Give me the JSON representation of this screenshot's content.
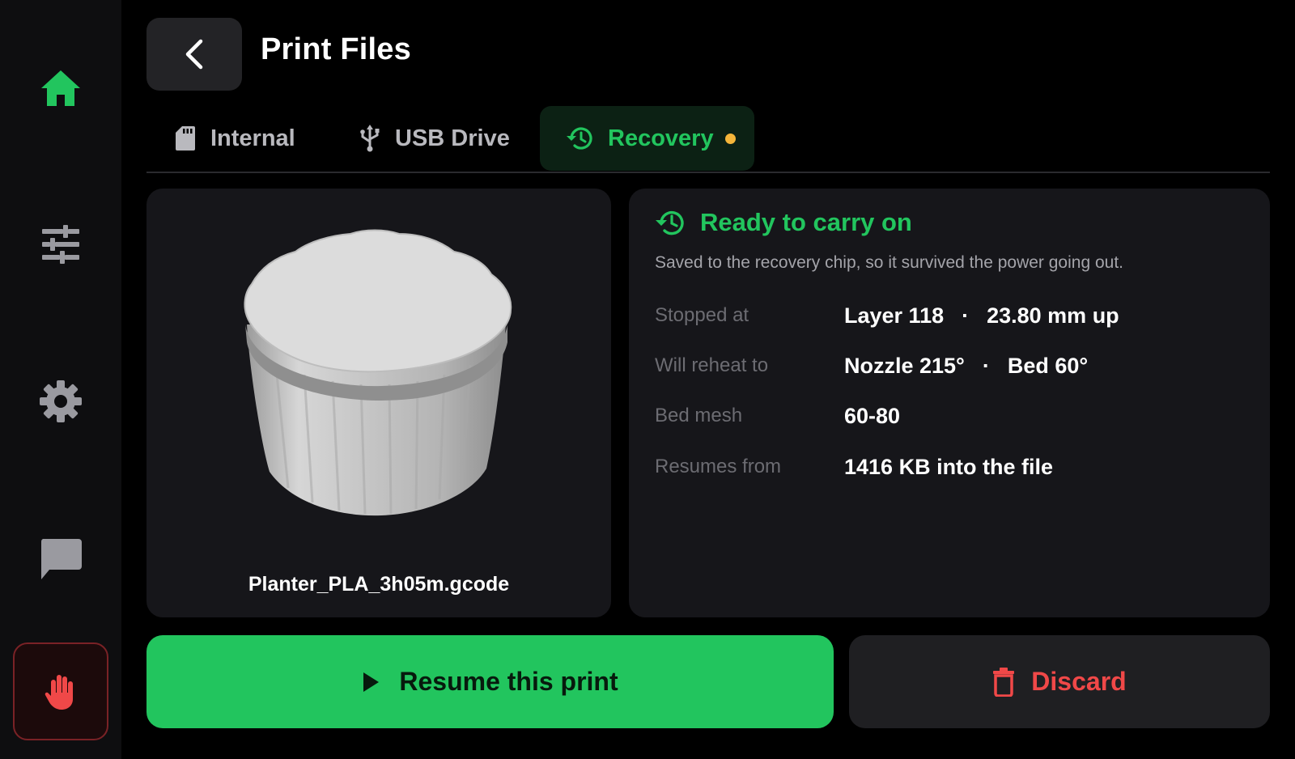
{
  "header": {
    "title": "Print Files"
  },
  "sidebar": {
    "items": [
      {
        "name": "home",
        "icon": "home-icon",
        "active": true
      },
      {
        "name": "tune",
        "icon": "sliders-icon"
      },
      {
        "name": "settings",
        "icon": "gear-icon"
      },
      {
        "name": "messages",
        "icon": "chat-icon"
      },
      {
        "name": "emergency-stop",
        "icon": "hand-icon"
      }
    ]
  },
  "tabs": [
    {
      "label": "Internal",
      "icon": "sd-card-icon"
    },
    {
      "label": "USB Drive",
      "icon": "usb-icon"
    },
    {
      "label": "Recovery",
      "icon": "history-icon",
      "active": true,
      "has_indicator": true
    }
  ],
  "preview": {
    "filename": "Planter_PLA_3h05m.gcode"
  },
  "recovery": {
    "title": "Ready to carry on",
    "subtitle": "Saved to the recovery chip, so it survived the power going out.",
    "rows": [
      {
        "label": "Stopped at",
        "value_a": "Layer 118",
        "separator": "·",
        "value_b": "23.80 mm up"
      },
      {
        "label": "Will reheat to",
        "value_a": "Nozzle 215°",
        "separator": "·",
        "value_b": "Bed 60°"
      },
      {
        "label": "Bed mesh",
        "value_a": "60-80"
      },
      {
        "label": "Resumes from",
        "value_a": "1416 KB into the file"
      }
    ]
  },
  "actions": {
    "resume_label": "Resume this print",
    "discard_label": "Discard"
  },
  "colors": {
    "accent": "#22c55e",
    "danger": "#f04848",
    "indicator": "#f5b53a",
    "background": "#000000",
    "card": "#16161a"
  }
}
